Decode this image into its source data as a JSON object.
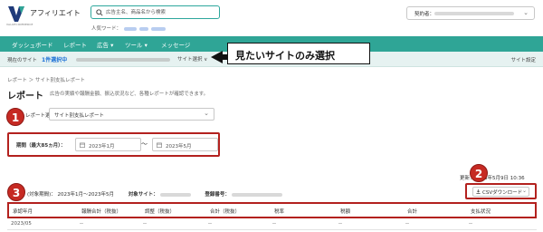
{
  "header": {
    "app_name": "アフィリエイト",
    "logo_sub": "VALUECOMMERCE",
    "search_placeholder": "広告主名、商品名から検索",
    "popular_label": "人気ワード：",
    "contract_label": "契約者："
  },
  "nav": {
    "items": [
      "ダッシュボード",
      "レポート",
      "広告 ▾",
      "ツール ▾",
      "メッセージ"
    ]
  },
  "subbar": {
    "current_site_label": "現在のサイト",
    "selected_count": "1件選択中",
    "site_select": "サイト選択 ∨",
    "site_settings": "サイト設定"
  },
  "callout": {
    "text": "見たいサイトのみ選択"
  },
  "breadcrumb": "レポート ＞ サイト別支払レポート",
  "page": {
    "title": "レポート",
    "description": "広告の実績や報酬金額、振込状況など、各種レポートが確認できます。"
  },
  "report": {
    "label": "レポート選択：",
    "value": "サイト別支払レポート"
  },
  "period": {
    "label": "期間（最大85ヵ月）：",
    "from": "2023年1月",
    "tilde": "〜",
    "to": "2023年5月"
  },
  "updated": "更新：2023年5月9日 10:36",
  "summary": {
    "period_label": "(対象期間)：",
    "period_value": "2023年1月〜2023年5月",
    "site_label": "対象サイト：",
    "reg_label": "登録番号："
  },
  "csv": {
    "label": "CSVダウンロード"
  },
  "table": {
    "headers": [
      "承認年月",
      "報酬合計（税抜）",
      "調整（税抜）",
      "合計（税抜）",
      "税率",
      "税額",
      "合計",
      "支払状況"
    ],
    "rows": [
      [
        "2023/05",
        "--",
        "--",
        "--",
        "--",
        "--",
        "--",
        "--"
      ]
    ]
  },
  "markers": [
    "1",
    "2",
    "3"
  ],
  "colors": {
    "nav": "#2fa596",
    "accent": "#1a6fd6",
    "marker": "#c62a23",
    "frame": "#b3211e"
  }
}
